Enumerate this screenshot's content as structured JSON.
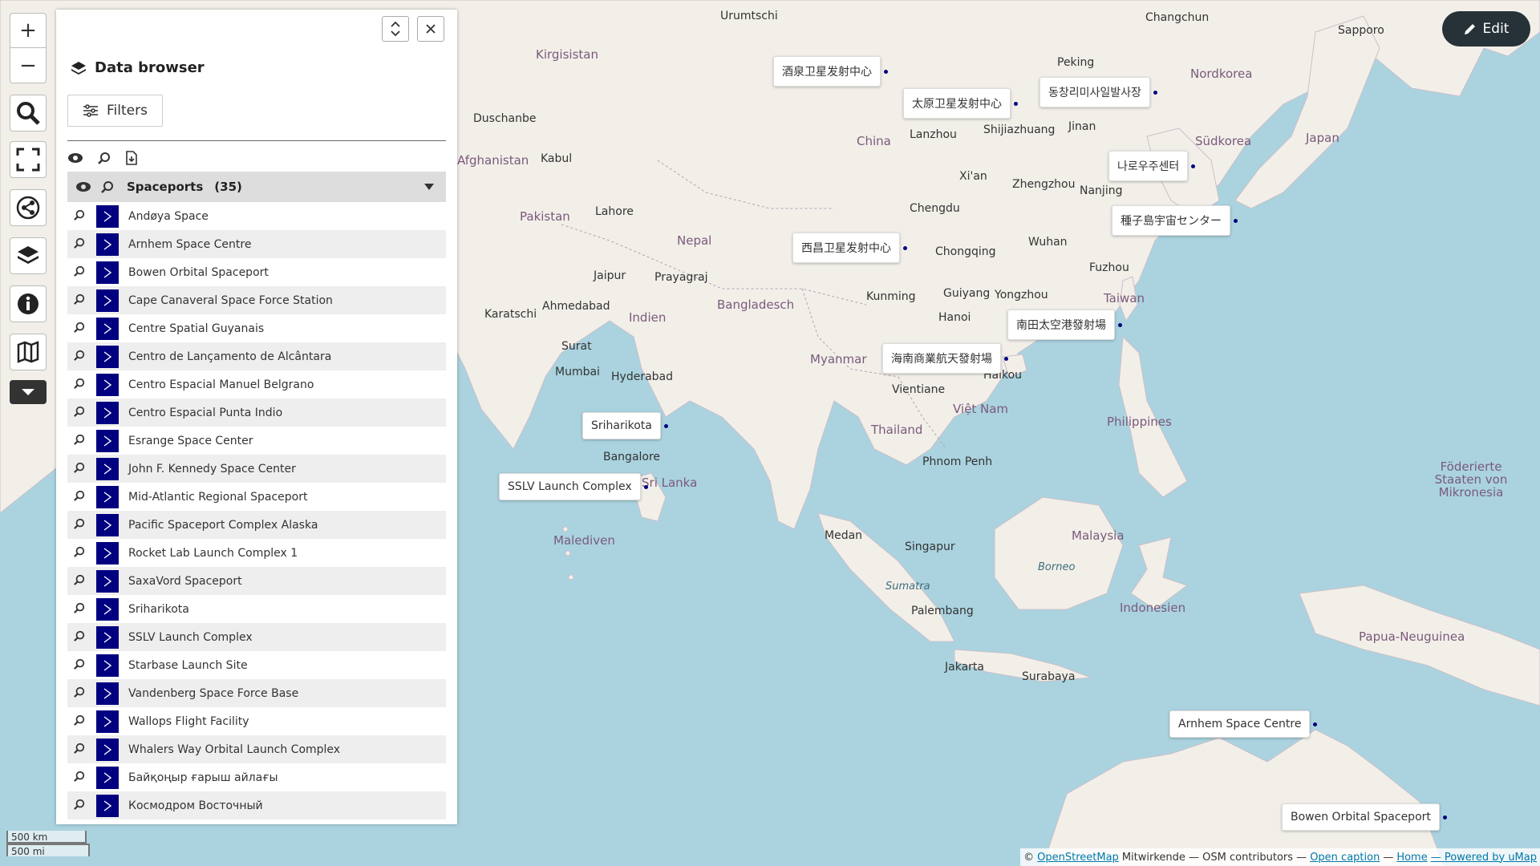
{
  "map": {
    "places": [
      {
        "text": "Urumtschi",
        "cls": "city"
      },
      {
        "text": "Changchun",
        "cls": "city"
      },
      {
        "text": "Sapporo",
        "cls": "city"
      },
      {
        "text": "Peking",
        "cls": "city"
      },
      {
        "text": "Jinan",
        "cls": "city"
      },
      {
        "text": "Shijiazhuang",
        "cls": "city"
      },
      {
        "text": "Lanzhou",
        "cls": "city"
      },
      {
        "text": "Xi'an",
        "cls": "city"
      },
      {
        "text": "Zhengzhou",
        "cls": "city"
      },
      {
        "text": "Nanjing",
        "cls": "city"
      },
      {
        "text": "Chengdu",
        "cls": "city"
      },
      {
        "text": "Chongqing",
        "cls": "city"
      },
      {
        "text": "Wuhan",
        "cls": "city"
      },
      {
        "text": "Fuzhou",
        "cls": "city"
      },
      {
        "text": "Kunming",
        "cls": "city"
      },
      {
        "text": "Guiyang",
        "cls": "city"
      },
      {
        "text": "Yongzhou",
        "cls": "city"
      },
      {
        "text": "Taiwan",
        "cls": "country"
      },
      {
        "text": "Hanoi",
        "cls": "city"
      },
      {
        "text": "Haikou",
        "cls": "city"
      },
      {
        "text": "Vientiane",
        "cls": "city"
      },
      {
        "text": "Việt Nam",
        "cls": "country"
      },
      {
        "text": "Thailand",
        "cls": "country"
      },
      {
        "text": "Phnom Penh",
        "cls": "city"
      },
      {
        "text": "Philippines",
        "cls": "country"
      },
      {
        "text": "Myanmar",
        "cls": "country"
      },
      {
        "text": "Bangladesch",
        "cls": "country"
      },
      {
        "text": "China",
        "cls": "country"
      },
      {
        "text": "Nepal",
        "cls": "country"
      },
      {
        "text": "Indien",
        "cls": "country"
      },
      {
        "text": "Pakistan",
        "cls": "country"
      },
      {
        "text": "Afghanistan",
        "cls": "country"
      },
      {
        "text": "Kabul",
        "cls": "city"
      },
      {
        "text": "Lahore",
        "cls": "city"
      },
      {
        "text": "Jaipur",
        "cls": "city"
      },
      {
        "text": "Prayagraj",
        "cls": "city"
      },
      {
        "text": "Ahmedabad",
        "cls": "city"
      },
      {
        "text": "Karatschi",
        "cls": "city"
      },
      {
        "text": "Surat",
        "cls": "city"
      },
      {
        "text": "Mumbai",
        "cls": "city"
      },
      {
        "text": "Hyderabad",
        "cls": "city"
      },
      {
        "text": "Bangalore",
        "cls": "city"
      },
      {
        "text": "Sri Lanka",
        "cls": "country"
      },
      {
        "text": "Malediven",
        "cls": "country"
      },
      {
        "text": "Duschanbe",
        "cls": "city"
      },
      {
        "text": "Kirgisistan",
        "cls": "country"
      },
      {
        "text": "Medan",
        "cls": "city"
      },
      {
        "text": "Singapur",
        "cls": "city"
      },
      {
        "text": "Malaysia",
        "cls": "country"
      },
      {
        "text": "Borneo",
        "cls": "sea"
      },
      {
        "text": "Sumatra",
        "cls": "sea"
      },
      {
        "text": "Palembang",
        "cls": "city"
      },
      {
        "text": "Jakarta",
        "cls": "city"
      },
      {
        "text": "Surabaya",
        "cls": "city"
      },
      {
        "text": "Indonesien",
        "cls": "country"
      },
      {
        "text": "Papua-Neuguinea",
        "cls": "country"
      },
      {
        "text": "Nordkorea",
        "cls": "country"
      },
      {
        "text": "Südkorea",
        "cls": "country"
      },
      {
        "text": "Japan",
        "cls": "country"
      },
      {
        "text": "Föderierte Staaten von Mikronesia",
        "cls": "country"
      }
    ],
    "markers": [
      {
        "label": "酒泉卫星发射中心"
      },
      {
        "label": "太原卫星发射中心"
      },
      {
        "label": "동창리미사일발사장"
      },
      {
        "label": "나로우주센터"
      },
      {
        "label": "種子島宇宙センター"
      },
      {
        "label": "西昌卫星发射中心"
      },
      {
        "label": "南田太空港發射場"
      },
      {
        "label": "海南商業航天發射場"
      },
      {
        "label": "Sriharikota"
      },
      {
        "label": "SSLV Launch Complex"
      },
      {
        "label": "Arnhem Space Centre"
      },
      {
        "label": "Bowen Orbital Spaceport"
      }
    ]
  },
  "controls": {
    "zoom_in": "+",
    "zoom_out": "−"
  },
  "panel": {
    "title": "Data browser",
    "filters_label": "Filters",
    "layer": {
      "name": "Spaceports",
      "count": "(35)"
    },
    "items": [
      "Andøya Space",
      "Arnhem Space Centre",
      "Bowen Orbital Spaceport",
      "Cape Canaveral Space Force Station",
      "Centre Spatial Guyanais",
      "Centro de Lançamento de Alcântara",
      "Centro Espacial Manuel Belgrano",
      "Centro Espacial Punta Indio",
      "Esrange Space Center",
      "John F. Kennedy Space Center",
      "Mid-Atlantic Regional Spaceport",
      "Pacific Spaceport Complex Alaska",
      "Rocket Lab Launch Complex 1",
      "SaxaVord Spaceport",
      "Sriharikota",
      "SSLV Launch Complex",
      "Starbase Launch Site",
      "Vandenberg Space Force Base",
      "Wallops Flight Facility",
      "Whalers Way Orbital Launch Complex",
      "Байқоңыр ғарыш айлағы",
      "Космодром Восточный"
    ]
  },
  "edit_label": "Edit",
  "attribution": {
    "copy": "©",
    "osm": "OpenStreetMap",
    "rest": "Mitwirkende — OSM contributors —",
    "caption": "Open caption",
    "sep1": "—",
    "home": "Home",
    "powered": "— Powered by uMap"
  },
  "scale": {
    "km": "500 km",
    "mi": "500 mi"
  },
  "colors": {
    "marker": "#000080",
    "water": "#aad3df",
    "land": "#f2efe9"
  }
}
